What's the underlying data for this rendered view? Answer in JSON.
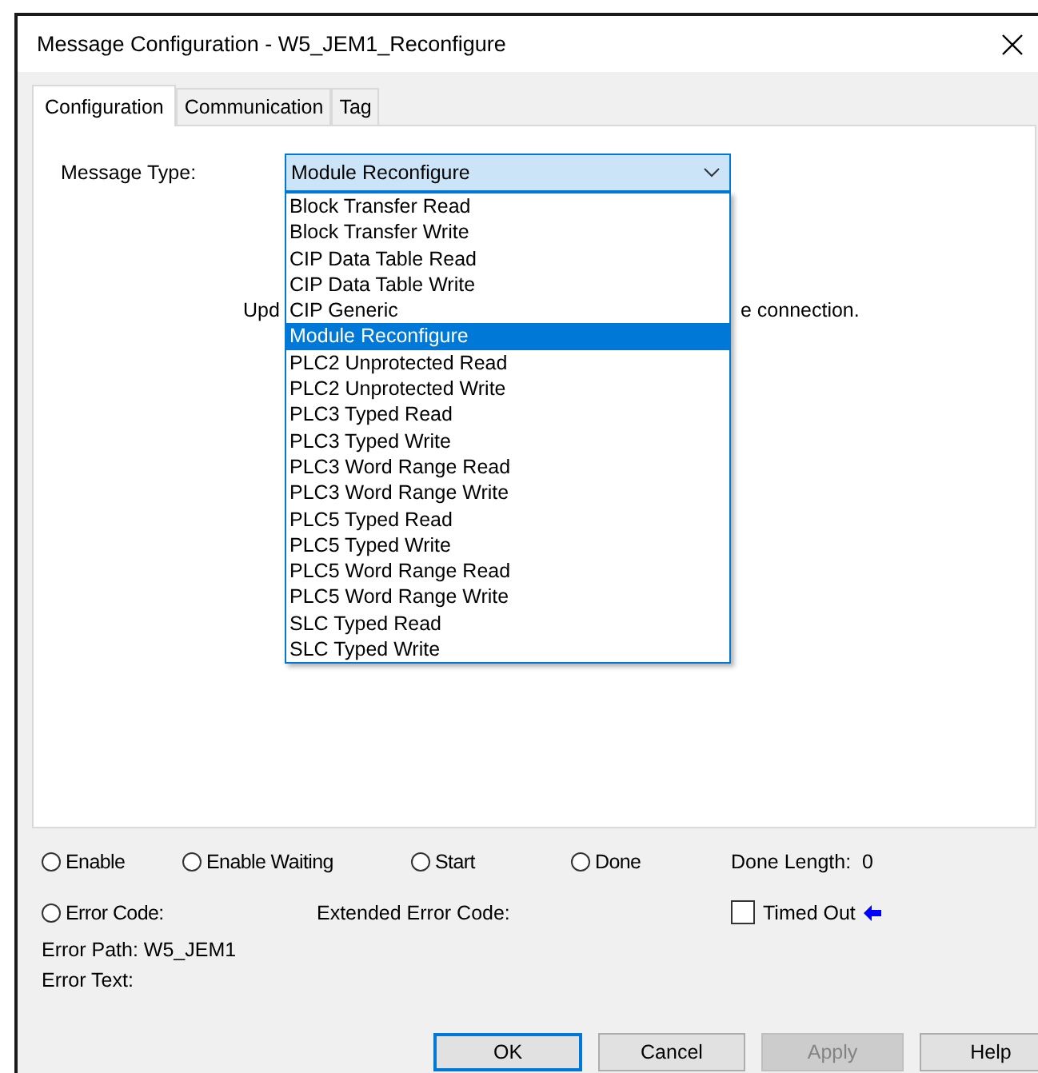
{
  "window": {
    "title": "Message Configuration - W5_JEM1_Reconfigure"
  },
  "tabs": [
    {
      "label": "Configuration",
      "selected": true
    },
    {
      "label": "Communication",
      "selected": false
    },
    {
      "label": "Tag",
      "selected": false
    }
  ],
  "message_type": {
    "label": "Message Type:",
    "value": "Module Reconfigure",
    "expanded": true,
    "options": [
      {
        "label": "Block Transfer Read",
        "selected": false
      },
      {
        "label": "Block Transfer Write",
        "selected": false
      },
      {
        "label": "CIP Data Table Read",
        "selected": false
      },
      {
        "label": "CIP Data Table Write",
        "selected": false
      },
      {
        "label": "CIP Generic",
        "selected": false
      },
      {
        "label": "Module Reconfigure",
        "selected": true
      },
      {
        "label": "PLC2 Unprotected Read",
        "selected": false
      },
      {
        "label": "PLC2 Unprotected Write",
        "selected": false
      },
      {
        "label": "PLC3 Typed Read",
        "selected": false
      },
      {
        "label": "PLC3 Typed Write",
        "selected": false
      },
      {
        "label": "PLC3 Word Range Read",
        "selected": false
      },
      {
        "label": "PLC3 Word Range Write",
        "selected": false
      },
      {
        "label": "PLC5 Typed Read",
        "selected": false
      },
      {
        "label": "PLC5 Typed Write",
        "selected": false
      },
      {
        "label": "PLC5 Word Range Read",
        "selected": false
      },
      {
        "label": "PLC5 Word Range Write",
        "selected": false
      },
      {
        "label": "SLC Typed Read",
        "selected": false
      },
      {
        "label": "SLC Typed Write",
        "selected": false
      }
    ]
  },
  "description": {
    "left": "Upd",
    "right": "e connection."
  },
  "status_flags": [
    {
      "label": "Enable",
      "checked": false
    },
    {
      "label": "Enable Waiting",
      "checked": false
    },
    {
      "label": "Start",
      "checked": false
    },
    {
      "label": "Done",
      "checked": false
    }
  ],
  "done_length": {
    "label": "Done Length:",
    "value": "0"
  },
  "error_code": {
    "label": "Error Code:",
    "checked": false
  },
  "extended_error_code": {
    "label": "Extended Error Code:"
  },
  "timed_out": {
    "label": "Timed Out",
    "checked": false
  },
  "error_path": {
    "label": "Error Path:",
    "value": "W5_JEM1"
  },
  "error_text": {
    "label": "Error Text:"
  },
  "buttons": [
    {
      "label": "OK",
      "default": true,
      "disabled": false
    },
    {
      "label": "Cancel",
      "default": false,
      "disabled": false
    },
    {
      "label": "Apply",
      "default": false,
      "disabled": true
    },
    {
      "label": "Help",
      "default": false,
      "disabled": false
    }
  ]
}
